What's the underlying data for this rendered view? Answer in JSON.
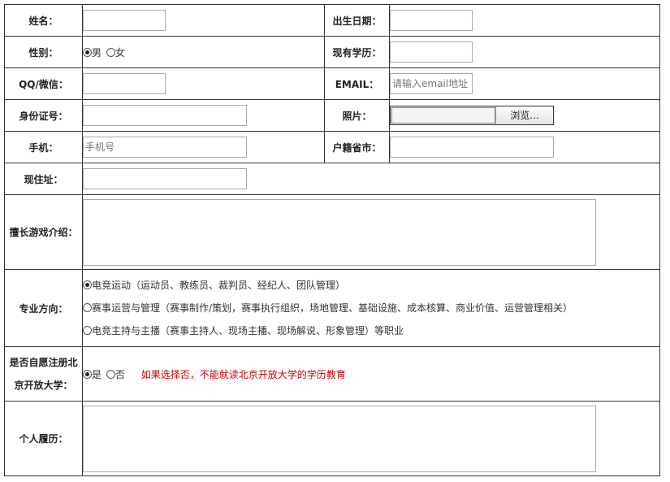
{
  "fields": {
    "name_label": "姓名：",
    "birth_label": "出生日期：",
    "gender_label": "性别：",
    "gender_male": "男",
    "gender_female": "女",
    "education_label": "现有学历：",
    "qq_label": "QQ/微信：",
    "email_label": "EMAIL：",
    "email_placeholder": "请输入email地址",
    "id_label": "身份证号：",
    "photo_label": "照片：",
    "browse_label": "浏览...",
    "phone_label": "手机：",
    "phone_placeholder": "手机号",
    "hukou_label": "户籍省市：",
    "address_label": "现住址：",
    "games_label": "擅长游戏介绍：",
    "major_label": "专业方向：",
    "major_options": [
      "电竞运动（运动员、教练员、裁判员、经纪人、团队管理）",
      "赛事运营与管理（赛事制作/策划，赛事执行组织，场地管理、基础设施、成本核算、商业价值、运营管理相关）",
      "电竞主持与主播（赛事主持人、现场主播、现场解说、形象管理）等职业"
    ],
    "enroll_label_line1": "是否自愿注册北",
    "enroll_label_line2": "京开放大学：",
    "enroll_yes": "是",
    "enroll_no": "否",
    "enroll_note": "如果选择否，不能就读北京开放大学的学历教育",
    "resume_label": "个人履历："
  },
  "state": {
    "gender": "男",
    "enroll": "是",
    "major_selected": 0
  },
  "colors": {
    "note": "#cc0000",
    "border": "#333333"
  }
}
